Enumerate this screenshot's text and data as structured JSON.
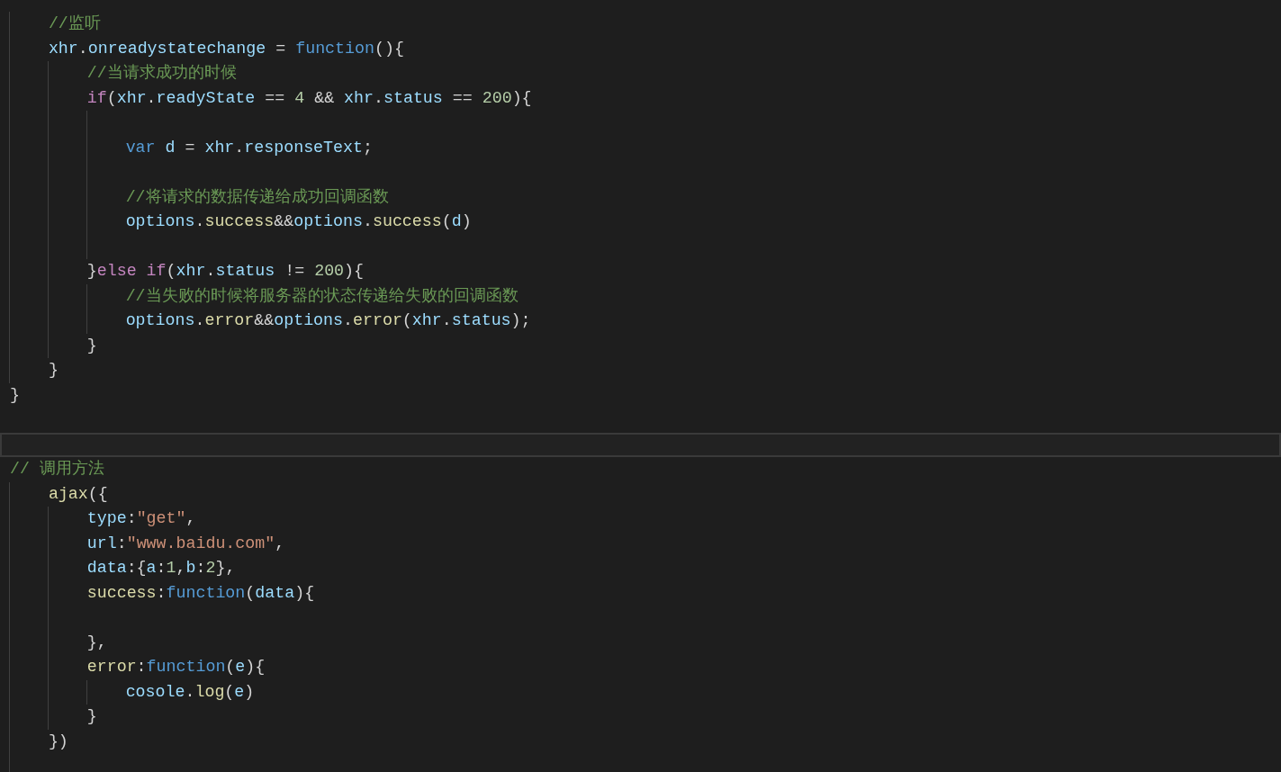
{
  "editor": {
    "lines": [
      {
        "children": [
          {
            "current": false,
            "tokens": [
              {
                "text": "//监听",
                "kind": "comment"
              }
            ]
          },
          {
            "current": false,
            "tokens": [
              {
                "text": "xhr",
                "kind": "var"
              },
              {
                "text": ".",
                "kind": "punct"
              },
              {
                "text": "onreadystatechange",
                "kind": "var"
              },
              {
                "text": " = ",
                "kind": "punct"
              },
              {
                "text": "function",
                "kind": "keyword"
              },
              {
                "text": "(){",
                "kind": "punct"
              }
            ]
          },
          {
            "children": [
              {
                "current": false,
                "tokens": [
                  {
                    "text": "//当请求成功的时候",
                    "kind": "comment"
                  }
                ]
              },
              {
                "current": false,
                "tokens": [
                  {
                    "text": "if",
                    "kind": "control"
                  },
                  {
                    "text": "(",
                    "kind": "punct"
                  },
                  {
                    "text": "xhr",
                    "kind": "var"
                  },
                  {
                    "text": ".",
                    "kind": "punct"
                  },
                  {
                    "text": "readyState",
                    "kind": "var"
                  },
                  {
                    "text": " == ",
                    "kind": "punct"
                  },
                  {
                    "text": "4",
                    "kind": "number"
                  },
                  {
                    "text": " && ",
                    "kind": "punct"
                  },
                  {
                    "text": "xhr",
                    "kind": "var"
                  },
                  {
                    "text": ".",
                    "kind": "punct"
                  },
                  {
                    "text": "status",
                    "kind": "var"
                  },
                  {
                    "text": " == ",
                    "kind": "punct"
                  },
                  {
                    "text": "200",
                    "kind": "number"
                  },
                  {
                    "text": "){",
                    "kind": "punct"
                  }
                ]
              },
              {
                "children": [
                  {
                    "current": false
                  },
                  {
                    "current": false,
                    "tokens": [
                      {
                        "text": "var ",
                        "kind": "keyword"
                      },
                      {
                        "text": "d",
                        "kind": "var"
                      },
                      {
                        "text": " = ",
                        "kind": "punct"
                      },
                      {
                        "text": "xhr",
                        "kind": "var"
                      },
                      {
                        "text": ".",
                        "kind": "punct"
                      },
                      {
                        "text": "responseText",
                        "kind": "var"
                      },
                      {
                        "text": ";",
                        "kind": "punct"
                      }
                    ]
                  },
                  {
                    "current": false
                  },
                  {
                    "current": false,
                    "tokens": [
                      {
                        "text": "//将请求的数据传递给成功回调函数",
                        "kind": "comment"
                      }
                    ]
                  },
                  {
                    "current": false,
                    "tokens": [
                      {
                        "text": "options",
                        "kind": "var"
                      },
                      {
                        "text": ".",
                        "kind": "punct"
                      },
                      {
                        "text": "success",
                        "kind": "func"
                      },
                      {
                        "text": "&&",
                        "kind": "punct"
                      },
                      {
                        "text": "options",
                        "kind": "var"
                      },
                      {
                        "text": ".",
                        "kind": "punct"
                      },
                      {
                        "text": "success",
                        "kind": "func"
                      },
                      {
                        "text": "(",
                        "kind": "punct"
                      },
                      {
                        "text": "d",
                        "kind": "var"
                      },
                      {
                        "text": ")",
                        "kind": "punct"
                      }
                    ]
                  },
                  {
                    "current": false
                  }
                ]
              },
              {
                "current": false,
                "tokens": [
                  {
                    "text": "}",
                    "kind": "punct"
                  },
                  {
                    "text": "else ",
                    "kind": "control"
                  },
                  {
                    "text": "if",
                    "kind": "control"
                  },
                  {
                    "text": "(",
                    "kind": "punct"
                  },
                  {
                    "text": "xhr",
                    "kind": "var"
                  },
                  {
                    "text": ".",
                    "kind": "punct"
                  },
                  {
                    "text": "status",
                    "kind": "var"
                  },
                  {
                    "text": " != ",
                    "kind": "punct"
                  },
                  {
                    "text": "200",
                    "kind": "number"
                  },
                  {
                    "text": "){",
                    "kind": "punct"
                  }
                ]
              },
              {
                "children": [
                  {
                    "current": false,
                    "tokens": [
                      {
                        "text": "//当失败的时候将服务器的状态传递给失败的回调函数",
                        "kind": "comment"
                      }
                    ]
                  },
                  {
                    "current": false,
                    "tokens": [
                      {
                        "text": "options",
                        "kind": "var"
                      },
                      {
                        "text": ".",
                        "kind": "punct"
                      },
                      {
                        "text": "error",
                        "kind": "func"
                      },
                      {
                        "text": "&&",
                        "kind": "punct"
                      },
                      {
                        "text": "options",
                        "kind": "var"
                      },
                      {
                        "text": ".",
                        "kind": "punct"
                      },
                      {
                        "text": "error",
                        "kind": "func"
                      },
                      {
                        "text": "(",
                        "kind": "punct"
                      },
                      {
                        "text": "xhr",
                        "kind": "var"
                      },
                      {
                        "text": ".",
                        "kind": "punct"
                      },
                      {
                        "text": "status",
                        "kind": "var"
                      },
                      {
                        "text": ");",
                        "kind": "punct"
                      }
                    ]
                  }
                ]
              },
              {
                "current": false,
                "tokens": [
                  {
                    "text": "}",
                    "kind": "punct"
                  }
                ]
              }
            ]
          },
          {
            "current": false,
            "tokens": [
              {
                "text": "}",
                "kind": "punct"
              }
            ]
          }
        ]
      },
      {
        "current": false,
        "tokens": [
          {
            "text": "}",
            "kind": "punct"
          }
        ]
      },
      {
        "current": false
      },
      {
        "current": true
      },
      {
        "current": false,
        "tokens": [
          {
            "text": "// 调用方法",
            "kind": "comment"
          }
        ]
      },
      {
        "children": [
          {
            "current": false,
            "tokens": [
              {
                "text": "ajax",
                "kind": "func"
              },
              {
                "text": "({",
                "kind": "punct"
              }
            ]
          },
          {
            "children": [
              {
                "current": false,
                "tokens": [
                  {
                    "text": "type",
                    "kind": "var"
                  },
                  {
                    "text": ":",
                    "kind": "punct"
                  },
                  {
                    "text": "\"get\"",
                    "kind": "string"
                  },
                  {
                    "text": ",",
                    "kind": "punct"
                  }
                ]
              },
              {
                "current": false,
                "tokens": [
                  {
                    "text": "url",
                    "kind": "var"
                  },
                  {
                    "text": ":",
                    "kind": "punct"
                  },
                  {
                    "text": "\"www.baidu.com\"",
                    "kind": "string"
                  },
                  {
                    "text": ",",
                    "kind": "punct"
                  }
                ]
              },
              {
                "current": false,
                "tokens": [
                  {
                    "text": "data",
                    "kind": "var"
                  },
                  {
                    "text": ":{",
                    "kind": "punct"
                  },
                  {
                    "text": "a",
                    "kind": "var"
                  },
                  {
                    "text": ":",
                    "kind": "punct"
                  },
                  {
                    "text": "1",
                    "kind": "number"
                  },
                  {
                    "text": ",",
                    "kind": "punct"
                  },
                  {
                    "text": "b",
                    "kind": "var"
                  },
                  {
                    "text": ":",
                    "kind": "punct"
                  },
                  {
                    "text": "2",
                    "kind": "number"
                  },
                  {
                    "text": "},",
                    "kind": "punct"
                  }
                ]
              },
              {
                "current": false,
                "tokens": [
                  {
                    "text": "success",
                    "kind": "func"
                  },
                  {
                    "text": ":",
                    "kind": "punct"
                  },
                  {
                    "text": "function",
                    "kind": "keyword"
                  },
                  {
                    "text": "(",
                    "kind": "punct"
                  },
                  {
                    "text": "data",
                    "kind": "var"
                  },
                  {
                    "text": "){",
                    "kind": "punct"
                  }
                ]
              },
              {
                "current": false
              },
              {
                "current": false,
                "tokens": [
                  {
                    "text": "},",
                    "kind": "punct"
                  }
                ]
              },
              {
                "current": false,
                "tokens": [
                  {
                    "text": "error",
                    "kind": "func"
                  },
                  {
                    "text": ":",
                    "kind": "punct"
                  },
                  {
                    "text": "function",
                    "kind": "keyword"
                  },
                  {
                    "text": "(",
                    "kind": "punct"
                  },
                  {
                    "text": "e",
                    "kind": "var"
                  },
                  {
                    "text": "){",
                    "kind": "punct"
                  }
                ]
              },
              {
                "children": [
                  {
                    "current": false,
                    "tokens": [
                      {
                        "text": "cosole",
                        "kind": "var"
                      },
                      {
                        "text": ".",
                        "kind": "punct"
                      },
                      {
                        "text": "log",
                        "kind": "func"
                      },
                      {
                        "text": "(",
                        "kind": "punct"
                      },
                      {
                        "text": "e",
                        "kind": "var"
                      },
                      {
                        "text": ")",
                        "kind": "punct"
                      }
                    ]
                  }
                ]
              },
              {
                "current": false,
                "tokens": [
                  {
                    "text": "}",
                    "kind": "punct"
                  }
                ]
              }
            ]
          },
          {
            "current": false,
            "tokens": [
              {
                "text": "})",
                "kind": "punct"
              }
            ]
          },
          {
            "current": false
          }
        ]
      }
    ]
  }
}
